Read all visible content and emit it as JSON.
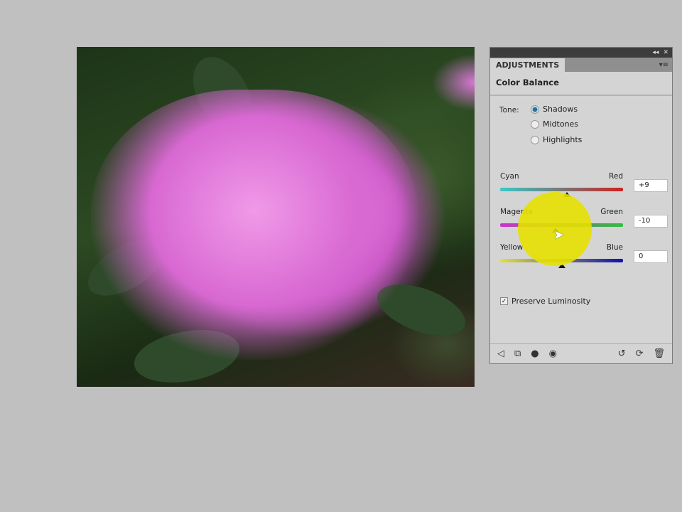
{
  "panel": {
    "tab": "ADJUSTMENTS",
    "title": "Color Balance",
    "tone_label": "Tone:",
    "tones": [
      {
        "label": "Shadows",
        "selected": true
      },
      {
        "label": "Midtones",
        "selected": false
      },
      {
        "label": "Highlights",
        "selected": false
      }
    ],
    "sliders": [
      {
        "left": "Cyan",
        "right": "Red",
        "value": "+9",
        "num": 9,
        "colors": [
          "#3cc8c8",
          "#d02020"
        ]
      },
      {
        "left": "Magenta",
        "right": "Green",
        "value": "-10",
        "num": -10,
        "colors": [
          "#d030d0",
          "#30c040"
        ]
      },
      {
        "left": "Yellow",
        "right": "Blue",
        "value": "0",
        "num": 0,
        "colors": [
          "#e0e040",
          "#1010b0"
        ]
      }
    ],
    "preserve_luminosity": {
      "label": "Preserve Luminosity",
      "checked": true
    }
  }
}
